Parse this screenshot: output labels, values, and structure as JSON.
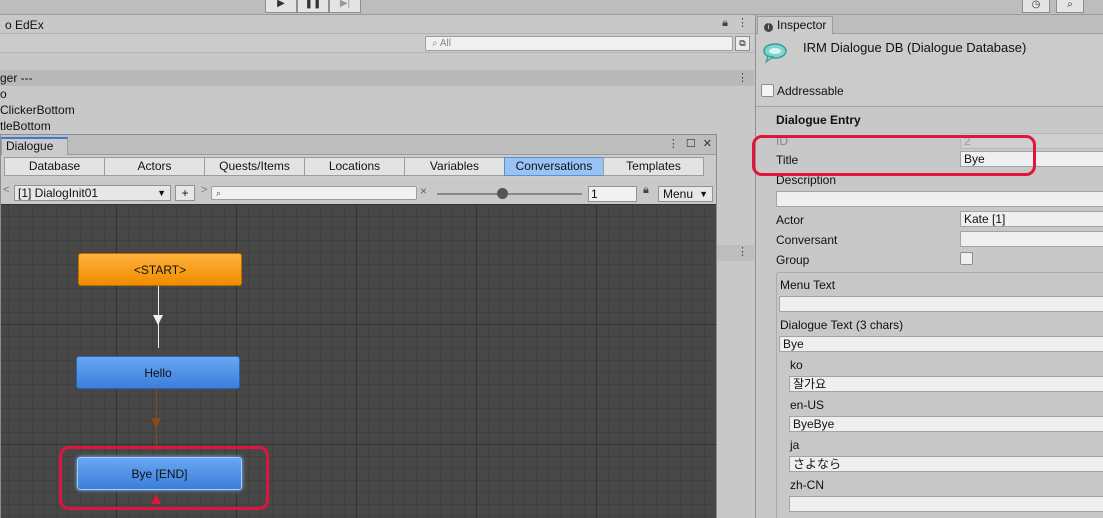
{
  "toolbar": {
    "play_icon": "play-icon",
    "pause_icon": "pause-icon",
    "step_icon": "step-icon"
  },
  "left_panel": {
    "title": "o EdEx",
    "search_placeholder": "All",
    "rows": [
      {
        "label": "ger ---",
        "highlighted": true
      },
      {
        "label": "o",
        "highlighted": false
      },
      {
        "label": "ClickerBottom",
        "highlighted": false
      },
      {
        "label": "tleBottom",
        "highlighted": false
      }
    ]
  },
  "dialogue": {
    "tab_label": "Dialogue",
    "nav_tabs": [
      {
        "label": "Database",
        "active": false
      },
      {
        "label": "Actors",
        "active": false
      },
      {
        "label": "Quests/Items",
        "active": false
      },
      {
        "label": "Locations",
        "active": false
      },
      {
        "label": "Variables",
        "active": false
      },
      {
        "label": "Conversations",
        "active": true
      },
      {
        "label": "Templates",
        "active": false
      }
    ],
    "conversation_select": "[1] DialogInit01",
    "add_label": "+",
    "clear_label": "×",
    "zoom_value": "1",
    "zoom_fraction": 0.45,
    "menu_label": "Menu",
    "nodes": {
      "start": "<START>",
      "hello": "Hello",
      "bye": "Bye [END]"
    }
  },
  "inspector": {
    "tab_label": "Inspector",
    "title": "IRM Dialogue DB (Dialogue Database)",
    "addressable_label": "Addressable",
    "section_title": "Dialogue Entry",
    "fields": {
      "id_label": "ID",
      "id_value": "2",
      "title_label": "Title",
      "title_value": "Bye",
      "description_label": "Description",
      "description_value": "",
      "actor_label": "Actor",
      "actor_value": "Kate [1]",
      "conversant_label": "Conversant",
      "conversant_value": "",
      "group_label": "Group"
    },
    "box": {
      "menu_text_label": "Menu Text",
      "menu_text_value": "",
      "dialogue_text_label": "Dialogue Text (3 chars)",
      "dialogue_text_value": "Bye",
      "localizations": [
        {
          "lang": "ko",
          "value": "잘가요"
        },
        {
          "lang": "en-US",
          "value": "ByeBye"
        },
        {
          "lang": "ja",
          "value": "さよなら"
        },
        {
          "lang": "zh-CN",
          "value": ""
        }
      ]
    }
  },
  "colors": {
    "highlight": "#e0143c",
    "active_tab": "#9ac3f5",
    "start_node": "#f5a000",
    "node_blue": "#4a8ee6"
  }
}
